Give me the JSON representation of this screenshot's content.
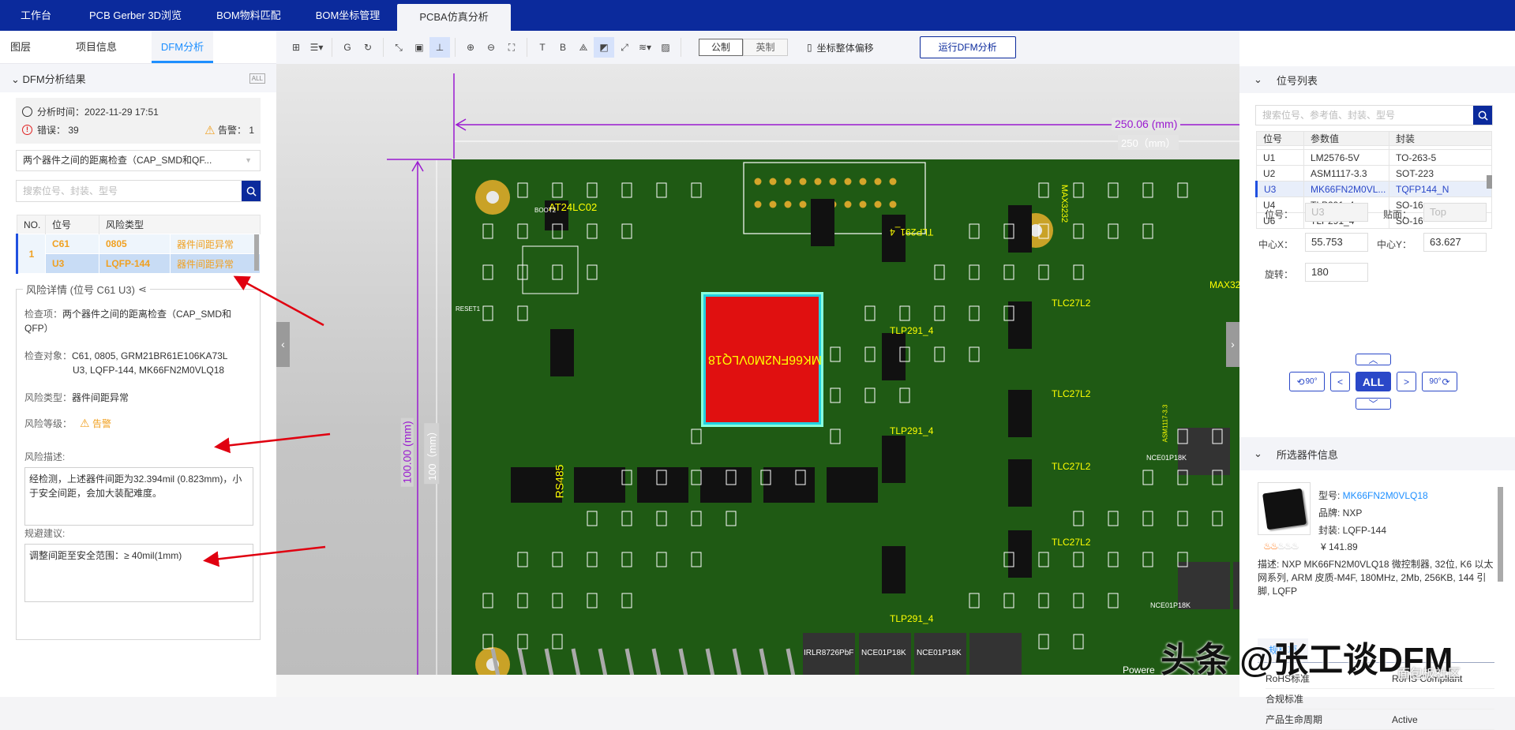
{
  "topnav": {
    "tabs": [
      "工作台",
      "PCB Gerber 3D浏览",
      "BOM物料匹配",
      "BOM坐标管理",
      "PCBA仿真分析"
    ],
    "active": 4
  },
  "left": {
    "tabs": [
      "图层",
      "项目信息",
      "DFM分析"
    ],
    "section_title": "DFM分析结果",
    "analysis_time": "分析时间：2022-11-29 17:51",
    "errors_label": "错误：",
    "errors": "39",
    "warnings_label": "告警：",
    "warnings": "1",
    "check_select": "两个器件之间的距离检查（CAP_SMD和QF...",
    "search_placeholder": "搜索位号、封装、型号",
    "table": {
      "headers": [
        "NO.",
        "位号",
        "风险类型"
      ],
      "rows": [
        {
          "no": "1",
          "ref": "C61",
          "pkg": "0805",
          "type": "器件间距异常"
        },
        {
          "ref": "U3",
          "pkg": "LQFP-144",
          "type": "器件间距异常"
        }
      ]
    },
    "detail": {
      "title": "风险详情 (位号 C61 U3)",
      "check_item_label": "检查项：",
      "check_item": "两个器件之间的距离检查（CAP_SMD和QFP）",
      "objects_label": "检查对象：",
      "objects_1": "C61, 0805, GRM21BR61E106KA73L",
      "objects_2": "U3, LQFP-144, MK66FN2M0VLQ18",
      "risk_type_label": "风险类型：",
      "risk_type": "器件间距异常",
      "risk_level_label": "风险等级：",
      "risk_level": "告警",
      "desc_label": "风险描述:",
      "desc": "经检测，上述器件间距为32.394mil (0.823mm)，小于安全间距，会加大装配难度。",
      "advice_label": "规避建议:",
      "advice": "调整间距至安全范围：≥ 40mil(1mm)"
    }
  },
  "toolbar": {
    "unit_metric": "公制",
    "unit_imperial": "英制",
    "offset_label": "坐标整体偏移",
    "run_dfm": "运行DFM分析",
    "icons": [
      "add-file-icon",
      "file-list-icon",
      "gerber-import-icon",
      "pcba-refresh-icon",
      "measure-icon",
      "ruler-icon",
      "dimension-icon",
      "zoom-in-icon",
      "zoom-out-icon",
      "zoom-fit-icon",
      "top-layer-icon",
      "bottom-layer-icon",
      "flip-icon",
      "3d-view-icon",
      "fullscreen-icon",
      "layers-icon",
      "image-icon"
    ]
  },
  "canvas": {
    "dim_width": "250.06 (mm)",
    "dim_width_ref": "250（mm）",
    "dim_height": "100.00 (mm)",
    "dim_height_ref": "100（mm）",
    "chip_label": "MK66FN2M0VLQ18",
    "labels": [
      "AT24LC02",
      "TLP291_4",
      "TLP291_4",
      "TLP291_4",
      "TLP291_4",
      "TLC27L2",
      "TLC27L2",
      "TLC27L2",
      "TLC27L2",
      "MAX3232",
      "RS485",
      "NCE01P18K",
      "NCE01P18K",
      "NCE01P18K",
      "NCE01P18K",
      "IRLR8726PbF",
      "RESET1",
      "BOOT2",
      "ASM1117-3.3",
      "MAX32"
    ],
    "powered": "Powere"
  },
  "right": {
    "ref_list_title": "位号列表",
    "search_placeholder": "搜索位号、参考值、封装、型号",
    "table": {
      "headers": [
        "位号",
        "参数值",
        "封装"
      ],
      "rows": [
        [
          "U1",
          "LM2576-5V",
          "TO-263-5"
        ],
        [
          "U2",
          "ASM1117-3.3",
          "SOT-223"
        ],
        [
          "U3",
          "MK66FN2M0VL...",
          "TQFP144_N"
        ],
        [
          "U4",
          "TLP291_4",
          "SO-16"
        ],
        [
          "U6",
          "TLP291_4",
          "SO-16"
        ]
      ],
      "selected": 2
    },
    "fields": {
      "ref_label": "位号：",
      "ref": "U3",
      "side_label": "贴面：",
      "side": "Top",
      "cx_label": "中心X：",
      "cx": "55.753",
      "cy_label": "中心Y：",
      "cy": "63.627",
      "rot_label": "旋转：",
      "rot": "180"
    },
    "nav": {
      "all": "ALL",
      "prev": "<",
      "next": ">",
      "rot_ccw": "90°",
      "rot_cw": "90°"
    },
    "part_title": "所选器件信息",
    "part": {
      "model_label": "型号: ",
      "model": "MK66FN2M0VLQ18",
      "brand": "品牌: NXP",
      "package": "封装: LQFP-144",
      "price": "¥ 141.89",
      "popularity": 2,
      "popularity_max": 5,
      "desc": "描述: NXP MK66FN2M0VLQ18 微控制器, 32位, K6 以太网系列, ARM 皮质-M4F, 180MHz, 2Mb, 256KB, 144 引脚, LQFP",
      "spec_tab": "规格项",
      "specs": [
        [
          "RoHS标准",
          "RoHS Compliant"
        ],
        [
          "合规标准",
          ""
        ],
        [
          "产品生命周期",
          "Active"
        ]
      ]
    }
  },
  "watermark": {
    "text": "头条 @张工谈DFM",
    "site": "面包板社区"
  },
  "colors": {
    "nav": "#0b2a9c",
    "accent": "#1e8fff",
    "warning": "#f0a020",
    "pcb": "#1f5a14",
    "chip": "#e01010",
    "dimension": "#9a1ad0",
    "annotation": "#e00010"
  }
}
